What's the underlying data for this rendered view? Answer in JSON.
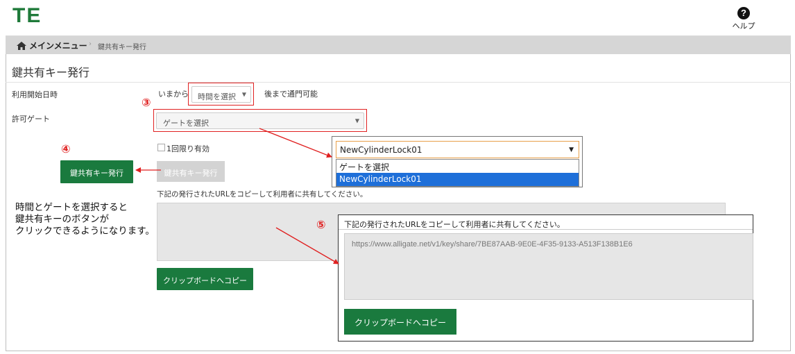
{
  "app": {
    "logo": "TE",
    "help_label": "ヘルプ"
  },
  "breadcrumb": {
    "home": "メインメニュー",
    "separator": "›",
    "current": "鍵共有キー発行"
  },
  "page_title": "鍵共有キー発行",
  "form": {
    "start_label": "利用開始日時",
    "start_prefix": "いまから",
    "time_select_value": "時間を選択",
    "start_suffix": "後まで通門可能",
    "gate_label": "許可ゲート",
    "gate_select_value": "ゲートを選択",
    "once_label": "1回限り有効",
    "issue_button_disabled": "鍵共有キー発行",
    "share_text": "下記の発行されたURLをコピーして利用者に共有してください。",
    "copy_button": "クリップボードへコピー"
  },
  "annotations": {
    "num3": "③",
    "num4": "④",
    "num5": "⑤",
    "issue_button_callout": "鍵共有キー発行",
    "note_lines": [
      "時間とゲートを選択すると",
      "鍵共有キーのボタンが",
      "クリックできるようになります。"
    ]
  },
  "dropdown_callout": {
    "selected": "NewCylinderLock01",
    "options": [
      "ゲートを選択",
      "NewCylinderLock01"
    ]
  },
  "copy_callout": {
    "text": "下記の発行されたURLをコピーして利用者に共有してください。",
    "url": "https://www.alligate.net/v1/key/share/7BE87AAB-9E0E-4F35-9133-A513F138B1E6",
    "button": "クリップボードへコピー"
  },
  "colors": {
    "accent_green": "#1a7a3e",
    "annotation_red": "#e02020",
    "breadcrumb_bg": "#d6d6d6"
  },
  "icons": {
    "help": "question-circle-icon",
    "home": "home-icon",
    "caret": "chevron-down-icon"
  }
}
